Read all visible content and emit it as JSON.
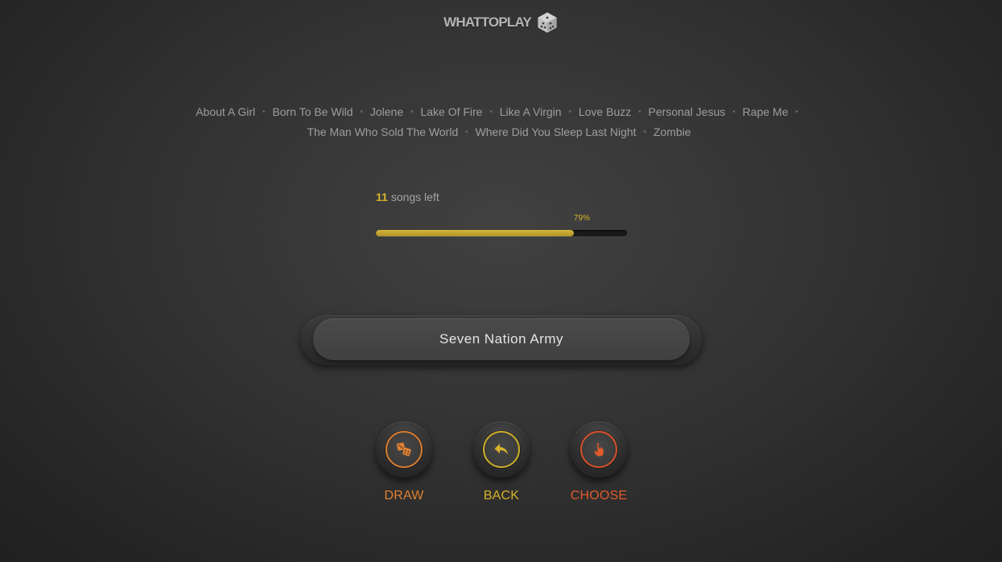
{
  "app": {
    "logo_text": "WHATTOPLAY",
    "logo_icon": "dice-icon"
  },
  "songs": [
    "About A Girl",
    "Born To Be Wild",
    "Jolene",
    "Lake Of Fire",
    "Like A Virgin",
    "Love Buzz",
    "Personal Jesus",
    "Rape Me",
    "The Man Who Sold The World",
    "Where Did You Sleep Last Night",
    "Zombie"
  ],
  "separator": "•",
  "progress": {
    "count": "11",
    "label": "songs left",
    "percent_label": "79%",
    "fraction": 0.79
  },
  "current_song": "Seven Nation Army",
  "actions": {
    "draw": {
      "label": "DRAW",
      "icon": "dice-icon",
      "color": "#e08130"
    },
    "back": {
      "label": "BACK",
      "icon": "reply-arrow-icon",
      "color": "#d8b22a"
    },
    "choose": {
      "label": "CHOOSE",
      "icon": "pointing-hand-icon",
      "color": "#e05a2c"
    }
  }
}
